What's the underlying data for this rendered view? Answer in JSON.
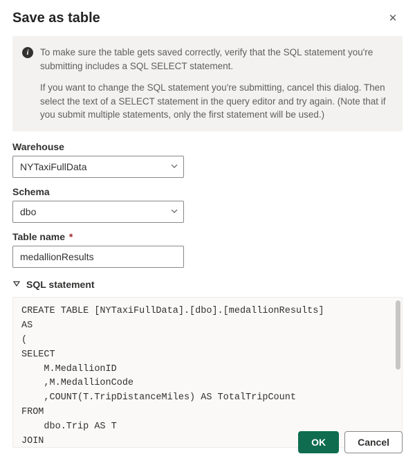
{
  "dialog": {
    "title": "Save as table",
    "close_glyph": "✕"
  },
  "info": {
    "p1": "To make sure the table gets saved correctly, verify that the SQL statement you're submitting includes a SQL SELECT statement.",
    "p2": "If you want to change the SQL statement you're submitting, cancel this dialog. Then select the text of a SELECT statement in the query editor and try again. (Note that if you submit multiple statements, only the first statement will be used.)"
  },
  "fields": {
    "warehouse": {
      "label": "Warehouse",
      "value": "NYTaxiFullData"
    },
    "schema": {
      "label": "Schema",
      "value": "dbo"
    },
    "tablename": {
      "label": "Table name",
      "required": "*",
      "value": "medallionResults"
    }
  },
  "sql": {
    "header": "SQL statement",
    "code": "CREATE TABLE [NYTaxiFullData].[dbo].[medallionResults]\nAS\n(\nSELECT\n    M.MedallionID\n    ,M.MedallionCode\n    ,COUNT(T.TripDistanceMiles) AS TotalTripCount\nFROM\n    dbo.Trip AS T\nJOIN"
  },
  "footer": {
    "ok": "OK",
    "cancel": "Cancel"
  }
}
